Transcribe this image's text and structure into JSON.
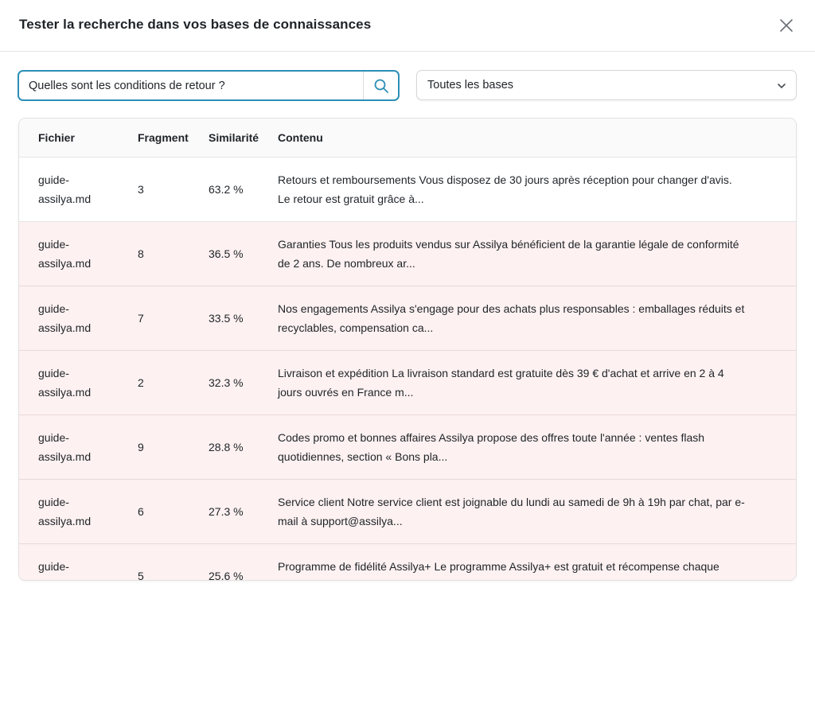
{
  "dialog": {
    "title": "Tester la recherche dans vos bases de connaissances",
    "close_icon": "close-icon"
  },
  "search": {
    "value": "Quelles sont les conditions de retour ?",
    "placeholder": "",
    "icon": "search-icon",
    "accent_color": "#2d8fb6"
  },
  "base_select": {
    "selected": "Toutes les bases",
    "icon": "chevron-down-icon"
  },
  "table": {
    "columns": [
      "Fichier",
      "Fragment",
      "Similarité",
      "Contenu"
    ],
    "highlight_color": "#fdf1f1",
    "rows": [
      {
        "file_line1": "guide-",
        "file_line2": "assilya.md",
        "fragment": "3",
        "similarity": "63.2 %",
        "content_line1": "Retours et remboursements Vous disposez de 30 jours après réception pour changer d'avis.",
        "content_line2": "Le retour est gratuit grâce à..."
      },
      {
        "file_line1": "guide-",
        "file_line2": "assilya.md",
        "fragment": "8",
        "similarity": "36.5 %",
        "content_line1": "Garanties Tous les produits vendus sur Assilya bénéficient de la garantie légale de conformité",
        "content_line2": "de 2 ans. De nombreux ar..."
      },
      {
        "file_line1": "guide-",
        "file_line2": "assilya.md",
        "fragment": "7",
        "similarity": "33.5 %",
        "content_line1": "Nos engagements Assilya s'engage pour des achats plus responsables : emballages réduits et",
        "content_line2": "recyclables, compensation ca..."
      },
      {
        "file_line1": "guide-",
        "file_line2": "assilya.md",
        "fragment": "2",
        "similarity": "32.3 %",
        "content_line1": "Livraison et expédition La livraison standard est gratuite dès 39 € d'achat et arrive en 2 à 4",
        "content_line2": "jours ouvrés en France m..."
      },
      {
        "file_line1": "guide-",
        "file_line2": "assilya.md",
        "fragment": "9",
        "similarity": "28.8 %",
        "content_line1": "Codes promo et bonnes affaires Assilya propose des offres toute l'année : ventes flash",
        "content_line2": "quotidiennes, section « Bons pla..."
      },
      {
        "file_line1": "guide-",
        "file_line2": "assilya.md",
        "fragment": "6",
        "similarity": "27.3 %",
        "content_line1": "Service client Notre service client est joignable du lundi au samedi de 9h à 19h par chat, par e-",
        "content_line2": "mail à support@assilya..."
      },
      {
        "file_line1": "guide-",
        "file_line2": "",
        "fragment": "5",
        "similarity": "25.6 %",
        "content_line1": "Programme de fidélité Assilya+ Le programme Assilya+ est gratuit et récompense chaque",
        "content_line2": ""
      }
    ]
  }
}
